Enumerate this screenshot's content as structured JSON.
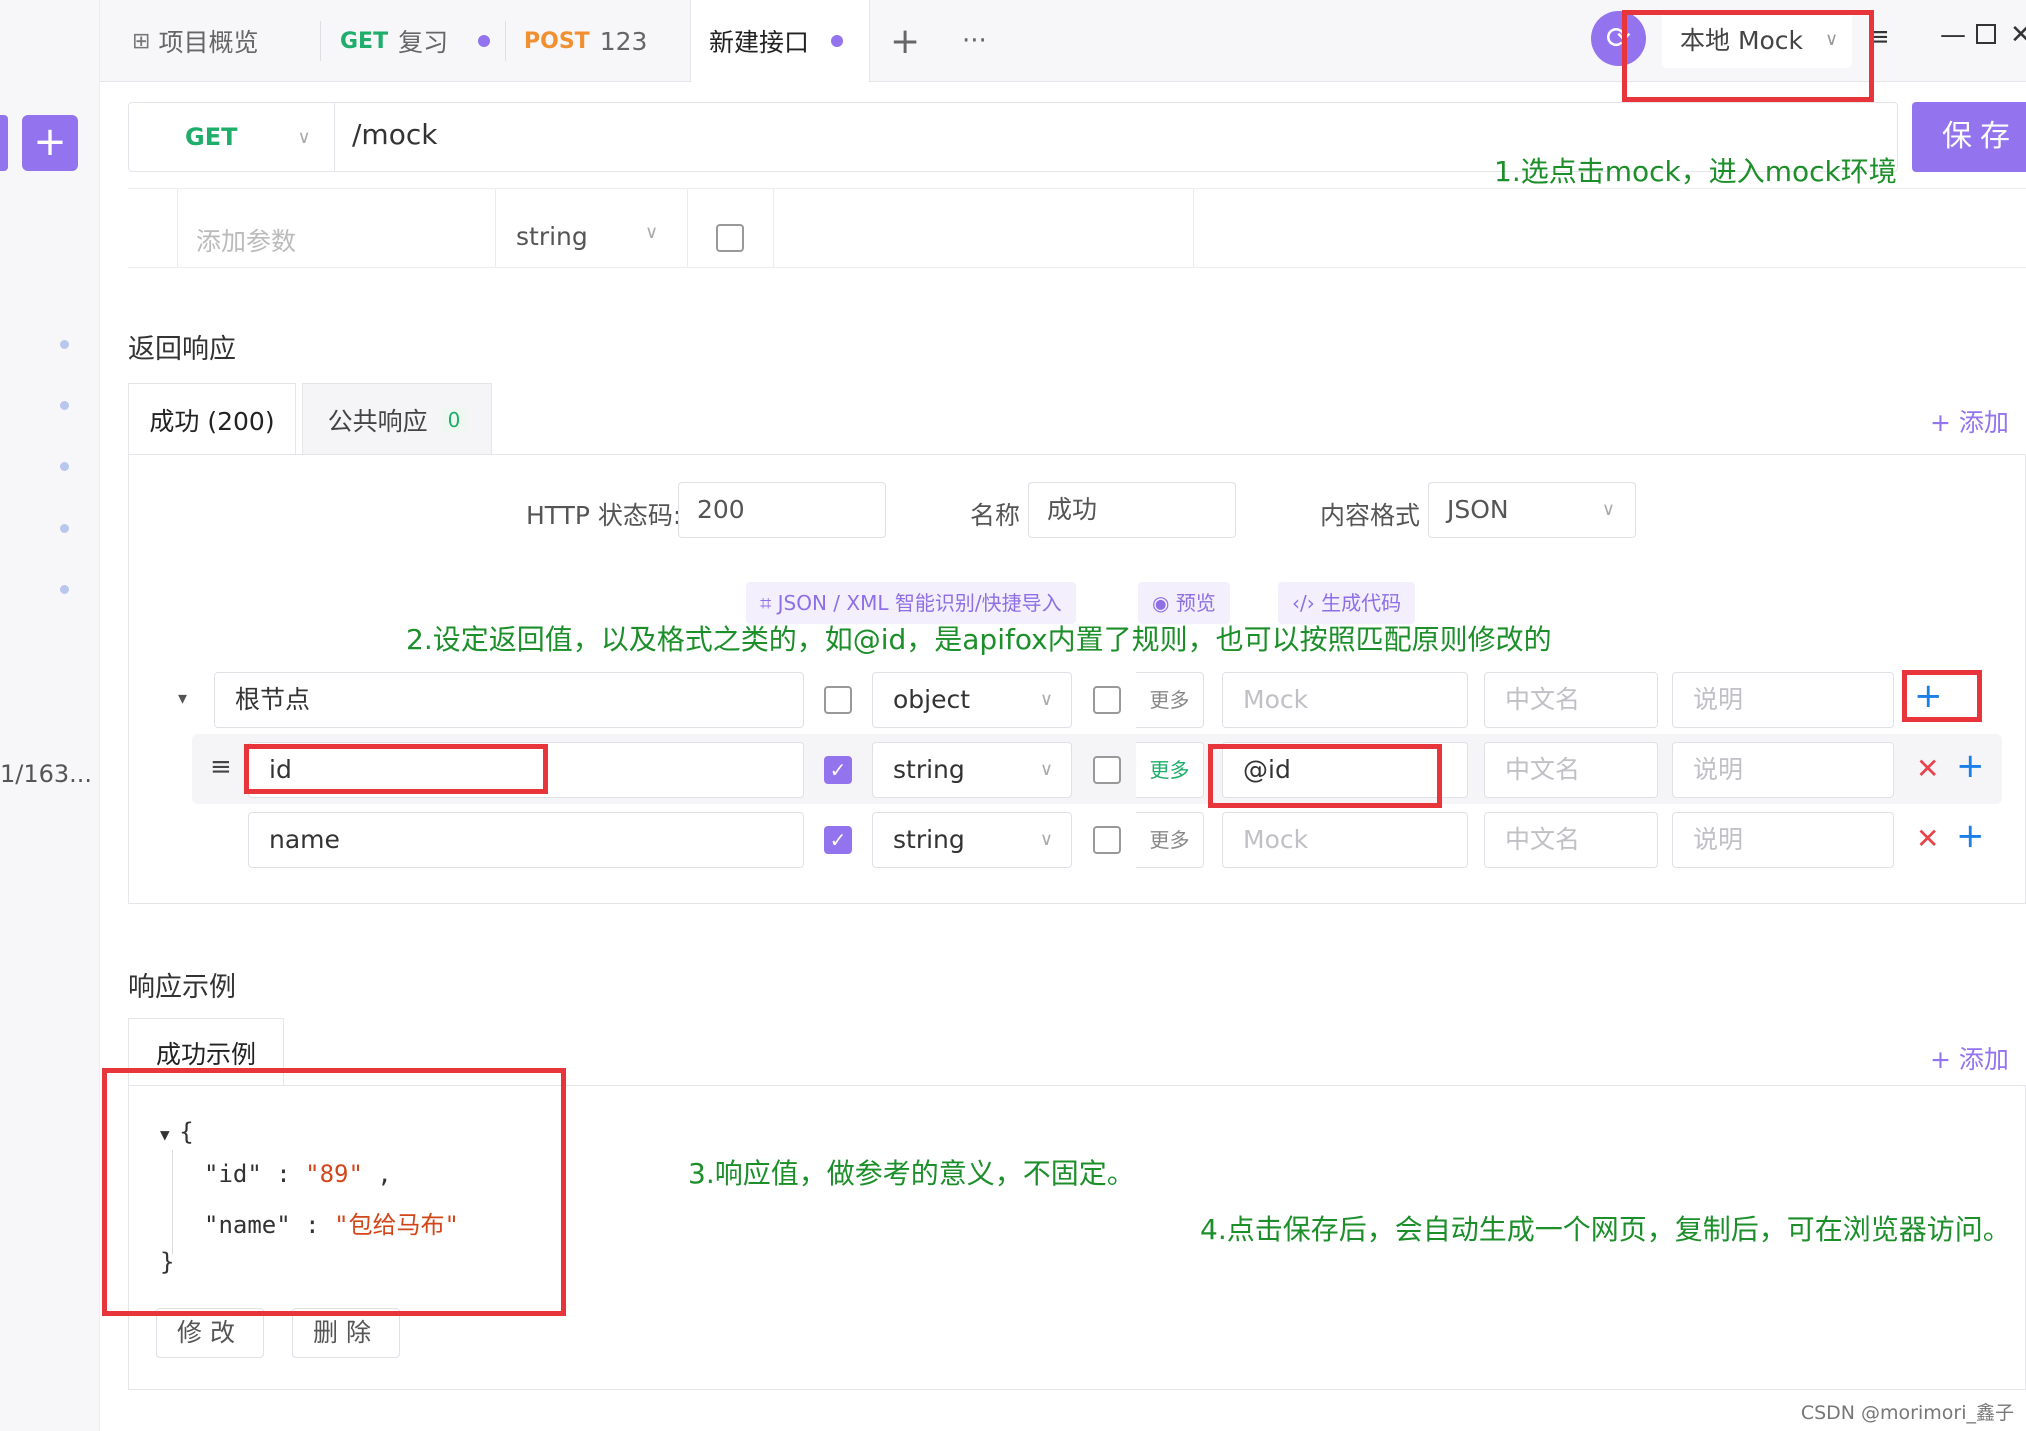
{
  "sidebar": {
    "truncated_text": "1/163..."
  },
  "tabs": [
    {
      "label": "项目概览",
      "icon": "grid-icon"
    },
    {
      "method": "GET",
      "label": "复习"
    },
    {
      "method": "POST",
      "label": "123"
    },
    {
      "label": "新建接口"
    }
  ],
  "tabbar": {
    "add": "+",
    "more": "···"
  },
  "env": {
    "label": "本地 Mock"
  },
  "request": {
    "method": "GET",
    "url": "/mock",
    "save": "保存"
  },
  "params": {
    "placeholder": "添加参数",
    "type": "string"
  },
  "response": {
    "title": "返回响应",
    "tab_success": "成功 (200)",
    "tab_public": "公共响应",
    "tab_public_count": "0",
    "add": "+ 添加",
    "http_label": "HTTP 状态码:",
    "http_value": "200",
    "name_label": "名称",
    "name_value": "成功",
    "format_label": "内容格式",
    "format_value": "JSON",
    "chip_import": "JSON / XML 智能识别/快捷导入",
    "chip_preview": "预览",
    "chip_code": "生成代码"
  },
  "schema": {
    "rows": [
      {
        "name": "根节点",
        "type": "object",
        "more": "更多",
        "mock": "Mock",
        "cn": "中文名",
        "desc": "说明"
      },
      {
        "name": "id",
        "type": "string",
        "more": "更多",
        "mock": "@id",
        "cn": "中文名",
        "desc": "说明"
      },
      {
        "name": "name",
        "type": "string",
        "more": "更多",
        "mock": "Mock",
        "cn": "中文名",
        "desc": "说明"
      }
    ]
  },
  "example": {
    "title": "响应示例",
    "tab": "成功示例",
    "add": "+ 添加",
    "open": "{",
    "line1_key": "\"id\"",
    "line1_val": "\"89\"",
    "line2_key": "\"name\"",
    "line2_val": "\"包给马布\"",
    "close": "}",
    "edit": "修改",
    "delete": "删除"
  },
  "annotations": {
    "note1": "1.选点击mock，进入mock环境",
    "note2": "2.设定返回值，以及格式之类的，如@id，是apifox内置了规则，也可以按照匹配原则修改的",
    "note3": "3.响应值，做参考的意义，不固定。",
    "note4": "4.点击保存后，会自动生成一个网页，复制后，可在浏览器访问。"
  },
  "credit": "CSDN @morimori_鑫子",
  "colors": {
    "accent": "#9373ee",
    "get": "#1ead6a",
    "post": "#f09030",
    "annotation_red": "#e8353c",
    "annotation_green": "#1c8f2a"
  }
}
